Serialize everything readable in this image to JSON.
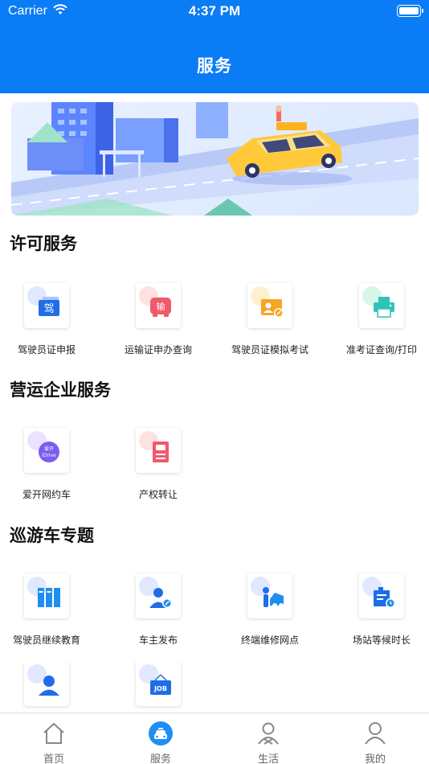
{
  "status_bar": {
    "carrier": "Carrier",
    "time": "4:37 PM"
  },
  "nav": {
    "title": "服务"
  },
  "banner": {
    "sign_text": "输"
  },
  "sections": [
    {
      "title": "许可服务",
      "items": [
        {
          "label": "驾驶员证申报",
          "icon": "driver-license-icon",
          "glyph": "驾"
        },
        {
          "label": "运输证申办查询",
          "icon": "transport-permit-icon",
          "glyph": "输"
        },
        {
          "label": "驾驶员证模拟考试",
          "icon": "mock-exam-icon",
          "glyph": ""
        },
        {
          "label": "准考证查询/打印",
          "icon": "printer-icon",
          "glyph": ""
        }
      ]
    },
    {
      "title": "营运企业服务",
      "items": [
        {
          "label": "爱开网约车",
          "icon": "idrive-icon",
          "glyph": "爱开\niDrive"
        },
        {
          "label": "产权转让",
          "icon": "ownership-transfer-icon",
          "glyph": ""
        }
      ]
    },
    {
      "title": "巡游车专题",
      "items": [
        {
          "label": "驾驶员继续教育",
          "icon": "books-icon",
          "glyph": ""
        },
        {
          "label": "车主发布",
          "icon": "owner-publish-icon",
          "glyph": ""
        },
        {
          "label": "终端维修网点",
          "icon": "repair-shop-icon",
          "glyph": ""
        },
        {
          "label": "场站等候时长",
          "icon": "station-wait-icon",
          "glyph": ""
        },
        {
          "label": "",
          "icon": "person-icon",
          "glyph": ""
        },
        {
          "label": "",
          "icon": "job-board-icon",
          "glyph": "JOB"
        }
      ]
    }
  ],
  "tabbar": [
    {
      "label": "首页",
      "icon": "home-icon",
      "active": false
    },
    {
      "label": "服务",
      "icon": "car-service-icon",
      "active": true
    },
    {
      "label": "生活",
      "icon": "life-icon",
      "active": false
    },
    {
      "label": "我的",
      "icon": "profile-icon",
      "active": false
    }
  ],
  "colors": {
    "primary": "#0a7cf5",
    "idrive": "#7b5cf0",
    "orange": "#f5a623",
    "red": "#f05a6a",
    "teal": "#2ec4b6"
  }
}
